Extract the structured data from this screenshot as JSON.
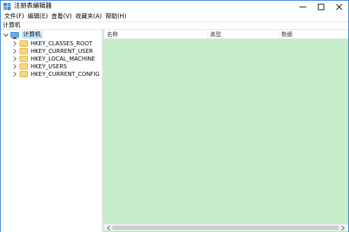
{
  "window": {
    "title": "注册表编辑器",
    "accent_color": "#2b78d4"
  },
  "menu": [
    "文件(F)",
    "编辑(E)",
    "查看(V)",
    "收藏夹(A)",
    "帮助(H)"
  ],
  "address": {
    "path": "计算机"
  },
  "tree": {
    "root": {
      "label": "计算机",
      "icon": "computer-icon",
      "expanded": true
    },
    "hives": [
      {
        "label": "HKEY_CLASSES_ROOT",
        "icon": "folder-icon"
      },
      {
        "label": "HKEY_CURRENT_USER",
        "icon": "folder-icon"
      },
      {
        "label": "HKEY_LOCAL_MACHINE",
        "icon": "folder-icon"
      },
      {
        "label": "HKEY_USERS",
        "icon": "folder-icon"
      },
      {
        "label": "HKEY_CURRENT_CONFIG",
        "icon": "folder-icon"
      }
    ]
  },
  "list": {
    "columns": [
      "名称",
      "类型",
      "数据"
    ],
    "background_color": "#c6ebc9"
  }
}
